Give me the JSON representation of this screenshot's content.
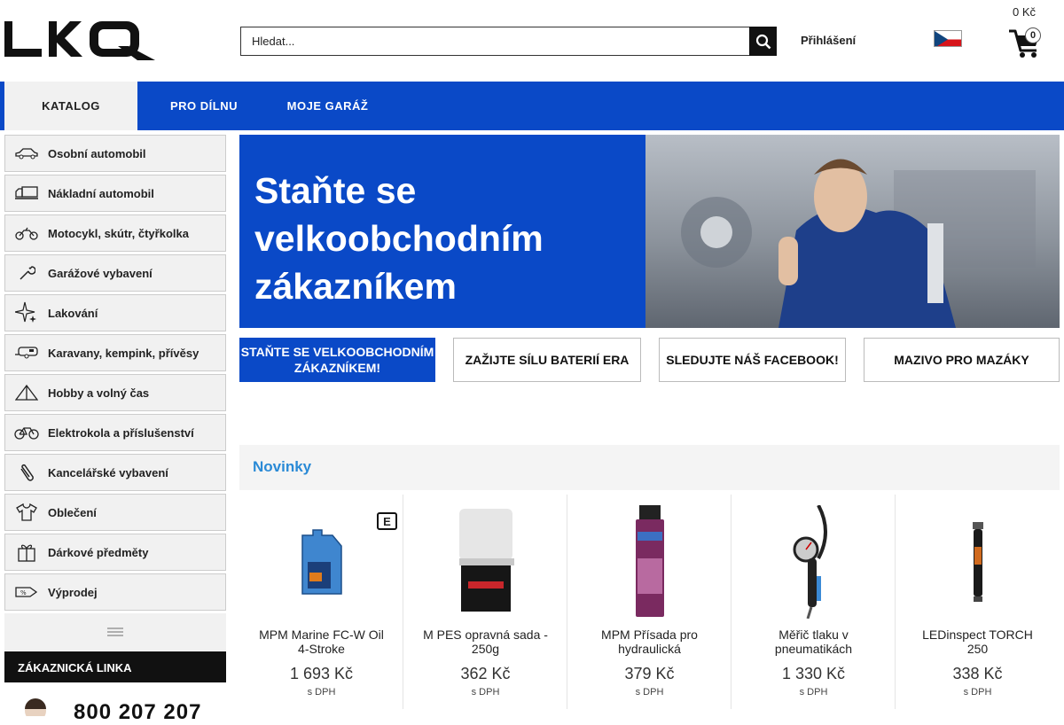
{
  "header": {
    "logo_text": "LKQ",
    "search_placeholder": "Hledat...",
    "login_label": "Přihlášení",
    "cart_total": "0 Kč",
    "cart_count": "0"
  },
  "nav": {
    "tabs": [
      "KATALOG",
      "PRO DÍLNU",
      "MOJE GARÁŽ"
    ]
  },
  "sidebar": {
    "items": [
      {
        "label": "Osobní automobil",
        "icon": "car-icon"
      },
      {
        "label": "Nákladní automobil",
        "icon": "truck-icon"
      },
      {
        "label": "Motocykl, skútr, čtyřkolka",
        "icon": "motorcycle-icon"
      },
      {
        "label": "Garážové vybavení",
        "icon": "wrench-icon"
      },
      {
        "label": "Lakování",
        "icon": "sparkle-icon"
      },
      {
        "label": "Karavany, kempink, přívěsy",
        "icon": "caravan-icon"
      },
      {
        "label": "Hobby a volný čas",
        "icon": "tent-icon"
      },
      {
        "label": "Elektrokola a příslušenství",
        "icon": "bicycle-icon"
      },
      {
        "label": "Kancelářské vybavení",
        "icon": "paperclip-icon"
      },
      {
        "label": "Oblečení",
        "icon": "tshirt-icon"
      },
      {
        "label": "Dárkové předměty",
        "icon": "gift-icon"
      },
      {
        "label": "Výprodej",
        "icon": "tag-icon"
      }
    ],
    "hotline_title": "ZÁKAZNICKÁ LINKA",
    "hotline_number": "800 207 207"
  },
  "banner": {
    "text": "Staňte se velkoobchodním zákazníkem"
  },
  "promos": [
    "STAŇTE SE VELKOOBCHODNÍM ZÁKAZNÍKEM!",
    "ZAŽIJTE SÍLU BATERIÍ ERA",
    "SLEDUJTE NÁŠ FACEBOOK!",
    "MAZIVO PRO MAZÁKY"
  ],
  "novinky": {
    "title": "Novinky",
    "products": [
      {
        "name": "MPM Marine FC-W Oil 4-Stroke",
        "price": "1 693 Kč",
        "vat": "s DPH",
        "badge": "E"
      },
      {
        "name": "M PES opravná sada - 250g",
        "price": "362 Kč",
        "vat": "s DPH"
      },
      {
        "name": "MPM Přísada pro hydraulická",
        "price": "379 Kč",
        "vat": "s DPH"
      },
      {
        "name": "Měřič tlaku v pneumatikách",
        "price": "1 330 Kč",
        "vat": "s DPH"
      },
      {
        "name": "LEDinspect TORCH 250",
        "price": "338 Kč",
        "vat": "s DPH"
      }
    ]
  },
  "colors": {
    "brand_blue": "#0a49c7",
    "accent_blue": "#2a8ad6"
  }
}
